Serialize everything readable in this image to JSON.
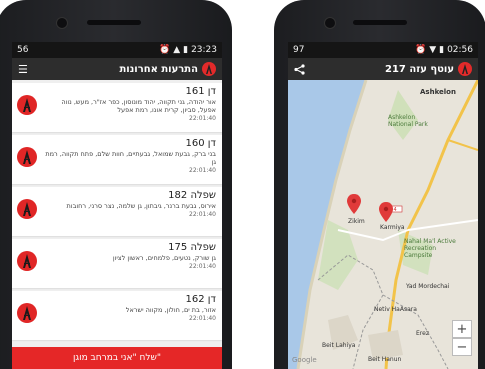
{
  "left_phone": {
    "status": {
      "battery_left": "56",
      "time": "23:23"
    },
    "appbar": {
      "title": "התרעות אחרונות"
    },
    "alerts": [
      {
        "name": "דן 161",
        "desc": "אור יהודה, גני תקווה, יהוד מונוסון, כפר אז\"ר, מעש, נווה אפעל, סביון, קרית אונו, רמת אפעל",
        "time": "22:01:40"
      },
      {
        "name": "דן 160",
        "desc": "בני ברק, גבעת שמואל, גבעתיים, חוות שלם, פתח תקווה, רמת גן",
        "time": "22:01:40"
      },
      {
        "name": "שפלה 182",
        "desc": "אירוס, גבעת ברנר, גיבתון, גן שלמה, נצר סרני, רחובות",
        "time": "22:01:40"
      },
      {
        "name": "שפלה 175",
        "desc": "גן שורק, נטעים, פלמחים, ראשון לציון",
        "time": "22:01:40"
      },
      {
        "name": "דן 162",
        "desc": "אזור, בת ים, חולון, מקווה ישראל",
        "time": "22:01:40"
      }
    ],
    "bottom_button": "שלח \"אני במרחב מוגן\""
  },
  "right_phone": {
    "status": {
      "battery_left": "97",
      "time": "02:56"
    },
    "appbar": {
      "title": "עוטף עזה 217"
    },
    "map": {
      "labels": {
        "ashkelon": "Ashkelon",
        "ashkelon_np": "Ashkelon National Park",
        "zikim": "Zikim",
        "karmiya": "Karmiya",
        "nahal": "Nahal Ma'l Active Recreation Campsite",
        "yad_mordechai": "Yad Mordechai",
        "netiv": "Netiv HaAsara",
        "erez": "Erez",
        "beit_lahiya": "Beit Lahiya",
        "beit_hanun": "Beit Hanun",
        "road": "4",
        "google": "Google"
      },
      "zoom_in": "+",
      "zoom_out": "−"
    }
  },
  "colors": {
    "accent_red": "#e52727",
    "appbar": "#2d2d2d",
    "sea": "#a9c8e8",
    "land": "#e9e5dc"
  }
}
